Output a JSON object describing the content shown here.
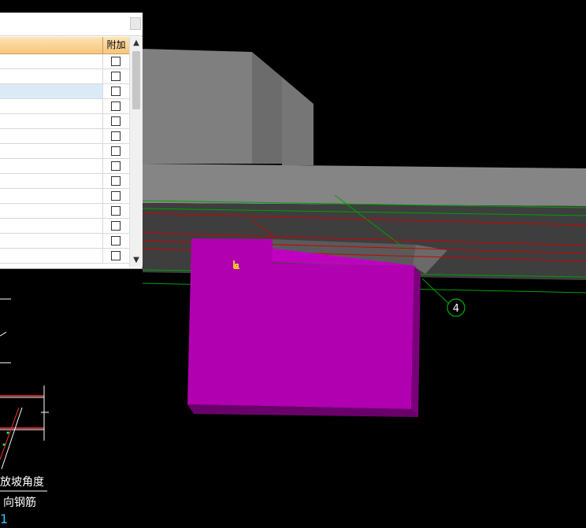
{
  "property_panel": {
    "column_header": "附加",
    "scroll_up_glyph": "▲",
    "scroll_down_glyph": "▼",
    "rows": [
      {
        "checked": false,
        "selected": false
      },
      {
        "checked": false,
        "selected": false
      },
      {
        "checked": false,
        "selected": true
      },
      {
        "checked": false,
        "selected": false
      },
      {
        "checked": false,
        "selected": false
      },
      {
        "checked": false,
        "selected": false
      },
      {
        "checked": false,
        "selected": false
      },
      {
        "checked": false,
        "selected": false
      },
      {
        "checked": false,
        "selected": false
      },
      {
        "checked": false,
        "selected": false
      },
      {
        "checked": false,
        "selected": false
      },
      {
        "checked": false,
        "selected": false
      },
      {
        "checked": false,
        "selected": false
      },
      {
        "checked": false,
        "selected": false
      }
    ]
  },
  "cad_drawing": {
    "text_slope_angle": "放坡角度",
    "text_rebar": "向钢筋",
    "text_number": "1"
  },
  "viewport": {
    "axis_label": "4",
    "colors": {
      "background": "#000000",
      "selected_element": "#b000b0",
      "beam_gray": "#7f7f7f",
      "grid_line_green": "#00a000",
      "grid_line_red": "#d00000",
      "origin_marker": "#ffff00"
    }
  }
}
